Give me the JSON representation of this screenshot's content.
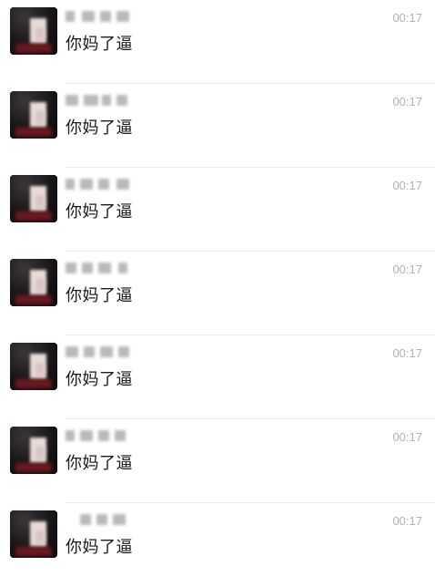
{
  "chats": [
    {
      "message": "你妈了逼",
      "time": "00:17"
    },
    {
      "message": "你妈了逼",
      "time": "00:17"
    },
    {
      "message": "你妈了逼",
      "time": "00:17"
    },
    {
      "message": "你妈了逼",
      "time": "00:17"
    },
    {
      "message": "你妈了逼",
      "time": "00:17"
    },
    {
      "message": "你妈了逼",
      "time": "00:17"
    },
    {
      "message": "你妈了逼",
      "time": "00:17"
    }
  ],
  "colors": {
    "background": "#ffffff",
    "message_text": "#1b1b1b",
    "time_text": "#b0b0b0",
    "divider": "#ececec"
  },
  "icons": {
    "avatar": "pixelated-avatar"
  }
}
